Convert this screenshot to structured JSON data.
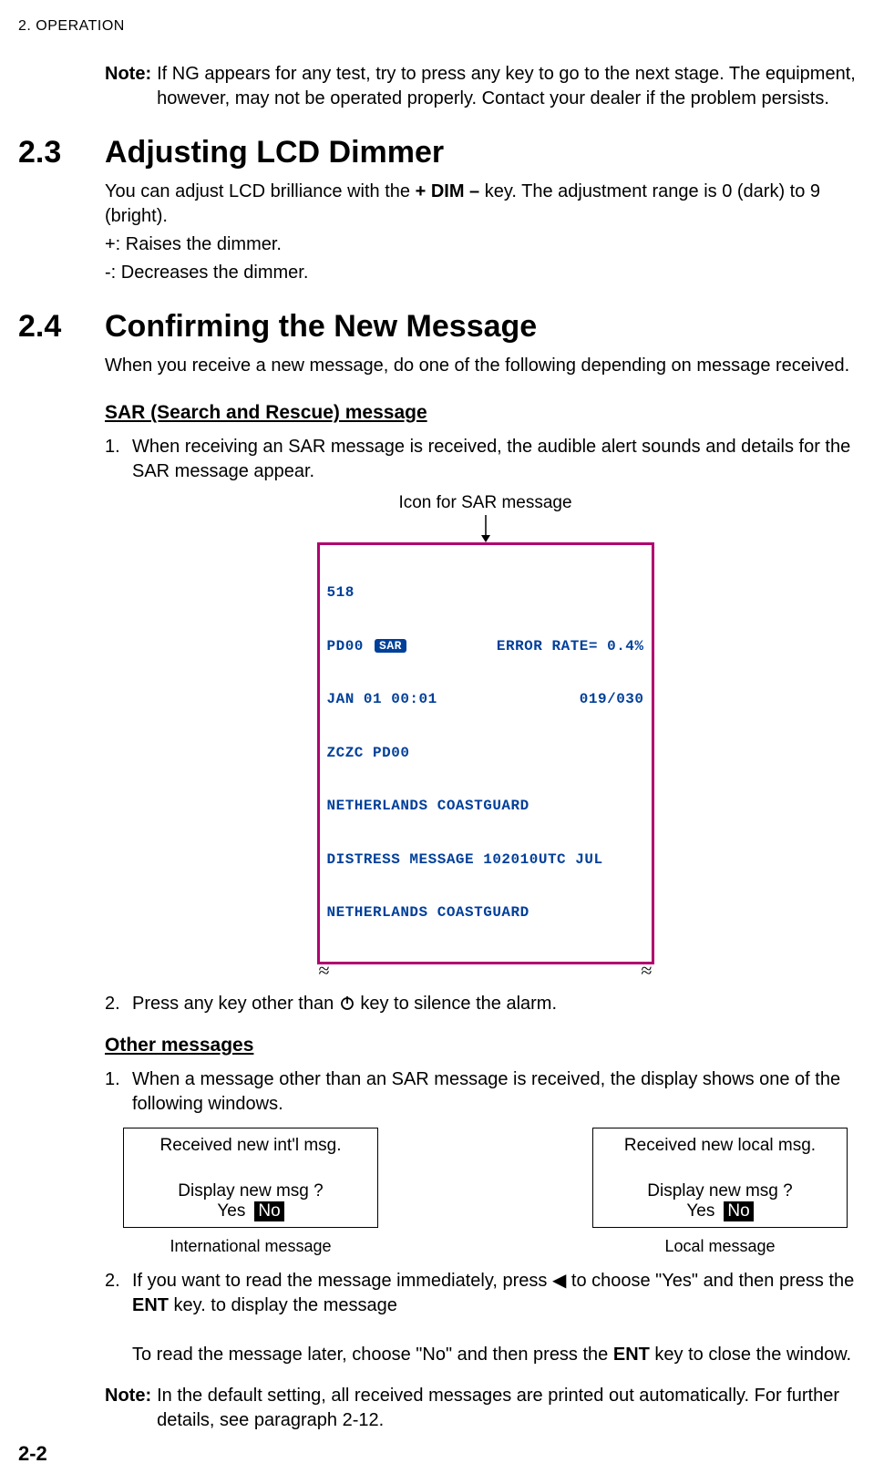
{
  "header": {
    "running": "2. OPERATION"
  },
  "note1": {
    "label": "Note:",
    "text": "If NG appears for any test, try to press any key to go to the next stage. The equipment, however, may not be operated properly. Contact your dealer if the problem persists."
  },
  "sec23": {
    "num": "2.3",
    "title": "Adjusting LCD Dimmer",
    "p1a": "You can adjust LCD brilliance with the ",
    "p1b": "+ DIM –",
    "p1c": " key. The adjustment range is 0 (dark) to 9 (bright).",
    "p2": "+: Raises the dimmer.",
    "p3": "-: Decreases the dimmer."
  },
  "sec24": {
    "num": "2.4",
    "title": "Confirming the New Message",
    "intro": "When you receive a new message, do one of the following depending on message received.",
    "sar": {
      "heading": "SAR (Search and Rescue) message",
      "item1": "When receiving an SAR message is received, the audible alert sounds and details for the SAR message appear.",
      "figcaption": "Icon for SAR message",
      "lcd": {
        "l1": "518",
        "l2_left": "PD00",
        "l2_right": "ERROR RATE= 0.4%",
        "sar_pill": "SAR",
        "l3_left": "JAN 01 00:01",
        "l3_right": "019/030",
        "l4": "ZCZC PD00",
        "l5": "NETHERLANDS COASTGUARD",
        "l6": "DISTRESS MESSAGE 102010UTC JUL",
        "l7": "NETHERLANDS COASTGUARD"
      },
      "tilde": "≈",
      "item2a": "Press any key other than ",
      "item2b": " key to silence the alarm."
    },
    "other": {
      "heading": "Other messages",
      "item1": "When a message other than an SAR message is received, the display shows one of the following windows.",
      "box1": {
        "title": "Received new int'l msg.",
        "q": "Display new msg ?",
        "yes": "Yes",
        "no": "No",
        "caption": "International message"
      },
      "box2": {
        "title": "Received new local msg.",
        "q": "Display new msg ?",
        "yes": "Yes",
        "no": "No",
        "caption": "Local message"
      },
      "item2a": "If you want to read the message immediately, press ◀ to choose \"Yes\" and then press the ",
      "item2b": "ENT",
      "item2c": " key. to display the message",
      "item2d": "To read the message later, choose \"No\" and then press the ",
      "item2e": "ENT",
      "item2f": " key to close the window.",
      "note_label": "Note:",
      "note_text": "In the default setting, all received messages are printed out automatically. For further details, see paragraph 2-12."
    }
  },
  "footer": {
    "page": "2-2"
  }
}
